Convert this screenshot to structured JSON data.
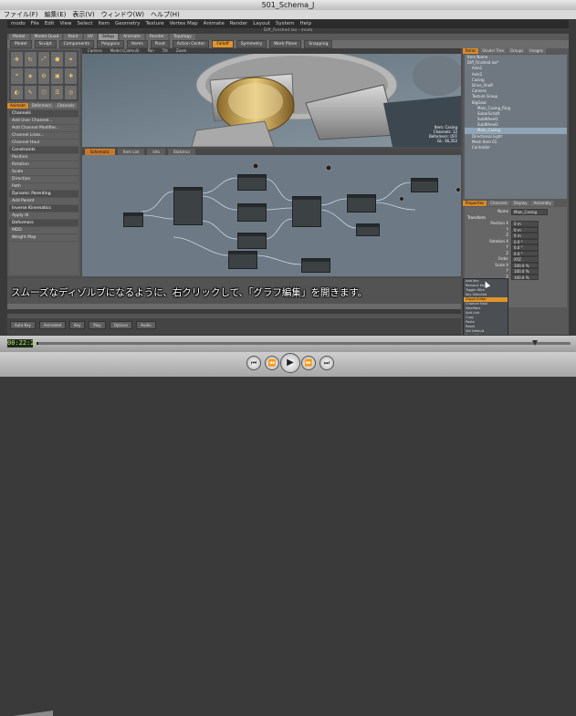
{
  "window": {
    "title": "501_Schema_J"
  },
  "os_menu": [
    "ファイル(F)",
    "編集(E)",
    "表示(V)",
    "ウィンドウ(W)",
    "ヘルプ(H)"
  ],
  "app": {
    "menu": [
      "modo",
      "File",
      "Edit",
      "View",
      "Select",
      "Item",
      "Geometry",
      "Texture",
      "Vertex Map",
      "Animate",
      "Render",
      "Layout",
      "System",
      "Help"
    ],
    "doc_title": "Diff_Finished.lxo - modo",
    "mode_tabs": [
      "Model",
      "Model Quad",
      "Paint",
      "UV",
      "Setup",
      "Animate",
      "Render",
      "Topology"
    ],
    "active_mode_tab": "Setup",
    "toolbar": [
      "Model",
      "Sculpt",
      "Components",
      "Polygons",
      "Items",
      "Pivot",
      "Action Center",
      "Falloff",
      "Symmetry",
      "Work Plane",
      "Snapping"
    ],
    "left_tabs": [
      "Animate",
      "Deformers",
      "Channels"
    ],
    "left_list": [
      {
        "label": "Channels",
        "hdr": true
      },
      {
        "label": "Add User Channel...",
        "hdr": false
      },
      {
        "label": "Add Channel Modifier...",
        "hdr": false
      },
      {
        "label": "Channel Links...",
        "hdr": false
      },
      {
        "label": "Channel Haul",
        "hdr": false
      },
      {
        "label": "Constraints",
        "hdr": true
      },
      {
        "label": "Position",
        "hdr": false
      },
      {
        "label": "Rotation",
        "hdr": false
      },
      {
        "label": "Scale",
        "hdr": false
      },
      {
        "label": "Direction",
        "hdr": false
      },
      {
        "label": "Path",
        "hdr": false
      },
      {
        "label": "Dynamic Parenting",
        "hdr": true
      },
      {
        "label": "Add Parent",
        "hdr": false
      },
      {
        "label": "Inverse Kinematics",
        "hdr": true
      },
      {
        "label": "Apply IK",
        "hdr": false
      },
      {
        "label": "Deformers",
        "hdr": true
      },
      {
        "label": "MDD",
        "hdr": false
      },
      {
        "label": "Weight Map",
        "hdr": false
      }
    ],
    "viewport_tabs": [
      "Camera",
      "Model (Catmull)",
      "Pan",
      "Tilt",
      "Zoom"
    ],
    "viewport_info": [
      "Item: Casing",
      "Channels: 12",
      "Deformers: OFF",
      "GL: 36,352"
    ],
    "schematic_tabs": [
      "Schematic",
      "Item List",
      "Info",
      "Statistics"
    ],
    "right_tabs": [
      "Items",
      "Shader Tree",
      "Groups",
      "Images"
    ],
    "item_list": [
      {
        "label": "Item Name",
        "sel": false
      },
      {
        "label": "Diff_Finished.lxo*",
        "sel": false
      },
      {
        "label": "Axle1",
        "sel": false
      },
      {
        "label": "Axle2",
        "sel": false
      },
      {
        "label": "Casing",
        "sel": false
      },
      {
        "label": "Drive_Shaft",
        "sel": false
      },
      {
        "label": "Camera",
        "sel": false
      },
      {
        "label": "Texture Group",
        "sel": false
      },
      {
        "label": "BigGear",
        "sel": false
      },
      {
        "label": "Main_Casing_Ring",
        "sel": false
      },
      {
        "label": "SubarSchaft",
        "sel": false
      },
      {
        "label": "SubWheel1",
        "sel": false
      },
      {
        "label": "SubWheel2",
        "sel": false
      },
      {
        "label": "Main_Casing",
        "sel": true
      },
      {
        "label": "Directional Light",
        "sel": false
      },
      {
        "label": "Mesh Item 01",
        "sel": false
      },
      {
        "label": "Controller",
        "sel": false
      }
    ],
    "prop_tabs": [
      "Properties",
      "Channels",
      "Display",
      "Assembly"
    ],
    "props": {
      "name_label": "Name",
      "name_value": "Main_Casing",
      "section": "Transform",
      "rows": [
        {
          "k": "Position X",
          "v": "0 m"
        },
        {
          "k": "Y",
          "v": "0 m"
        },
        {
          "k": "Z",
          "v": "0 m"
        },
        {
          "k": "Rotation X",
          "v": "0.0 °"
        },
        {
          "k": "Y",
          "v": "0.0 °"
        },
        {
          "k": "Z",
          "v": "0.0 °"
        },
        {
          "k": "Order",
          "v": "XYZ"
        },
        {
          "k": "Scale X",
          "v": "100.0 %"
        },
        {
          "k": "Y",
          "v": "100.0 %"
        },
        {
          "k": "Z",
          "v": "100.0 %"
        }
      ]
    },
    "context_menu": [
      "Add Key",
      "Remove Key",
      "Toggle Wire",
      "Key Selected",
      "Graph Editor",
      "Channel Haul",
      "Modifiers",
      "Add Link",
      "Copy",
      "Paste",
      "Reset",
      "Set Default",
      "Reset Zero"
    ],
    "context_highlight": 4,
    "bottom_buttons": [
      "Auto Key",
      "Animated",
      "Key",
      "Play",
      "Options",
      "Audio"
    ],
    "subtitle": "スムーズなディゾルブになるように、右クリックして、「グラフ編集」を開きます。"
  },
  "player": {
    "time": "00:22:22",
    "progress_fraction": 0.93,
    "controls": [
      "skip-back",
      "rewind",
      "play",
      "fast-forward",
      "skip-forward"
    ]
  }
}
